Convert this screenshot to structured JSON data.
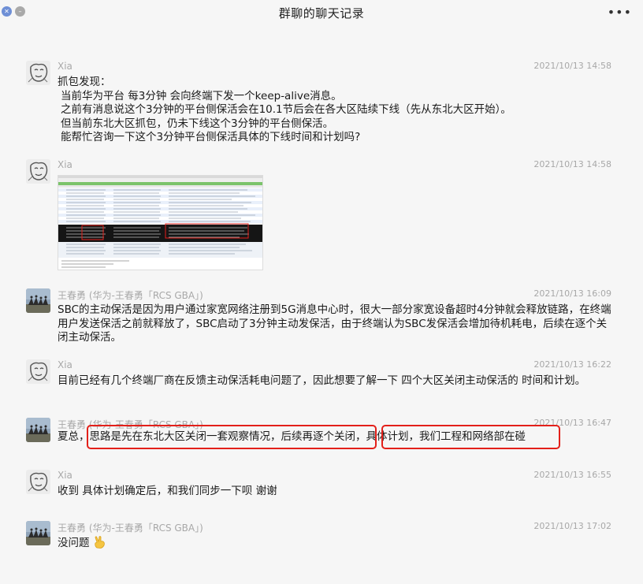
{
  "window": {
    "title": "群聊的聊天记录",
    "more_label": "•••"
  },
  "messages": [
    {
      "sender": "Xia",
      "time": "2021/10/13 14:58",
      "lines": [
        "抓包发现：",
        "当前华为平台 每3分钟 会向终端下发一个keep-alive消息。",
        "之前有消息说这个3分钟的平台侧保活会在10.1节后会在各大区陆续下线（先从东北大区开始）。",
        "但当前东北大区抓包，仍未下线这个3分钟的平台侧保活。",
        "能帮忙咨询一下这个3分钟平台侧保活具体的下线时间和计划吗?"
      ]
    },
    {
      "sender": "Xia",
      "time": "2021/10/13 14:58"
    },
    {
      "sender": "王春勇 (华为-王春勇「RCS GBA」)",
      "time": "2021/10/13 16:09",
      "text": "SBC的主动保活是因为用户通过家宽网络注册到5G消息中心时，很大一部分家宽设备超时4分钟就会释放链路，在终端用户发送保活之前就释放了，SBC启动了3分钟主动发保活，由于终端认为SBC发保活会增加待机耗电，后续在逐个关闭主动保活。"
    },
    {
      "sender": "Xia",
      "time": "2021/10/13 16:22",
      "text": "目前已经有几个终端厂商在反馈主动保活耗电问题了，因此想要了解一下  四个大区关闭主动保活的 时间和计划。"
    },
    {
      "sender": "王春勇 (华为-王春勇「RCS GBA」)",
      "time": "2021/10/13 16:47",
      "part1": "夏总，",
      "part2": "思路是先在东北大区关闭一套观察情况，后续再逐个关闭",
      "part3": "，",
      "part4": "具体计划，我们工程和网络部在碰"
    },
    {
      "sender": "Xia",
      "time": "2021/10/13 16:55",
      "text": "收到    具体计划确定后，和我们同步一下呗  谢谢"
    },
    {
      "sender": "王春勇 (华为-王春勇「RCS GBA」)",
      "time": "2021/10/13 17:02",
      "text": "没问题"
    }
  ],
  "colors": {
    "highlight": "#e3201a",
    "meta": "#a8a8a8"
  },
  "icons": [
    "close-icon",
    "minimize-icon",
    "more-icon",
    "victory-hand-icon"
  ]
}
